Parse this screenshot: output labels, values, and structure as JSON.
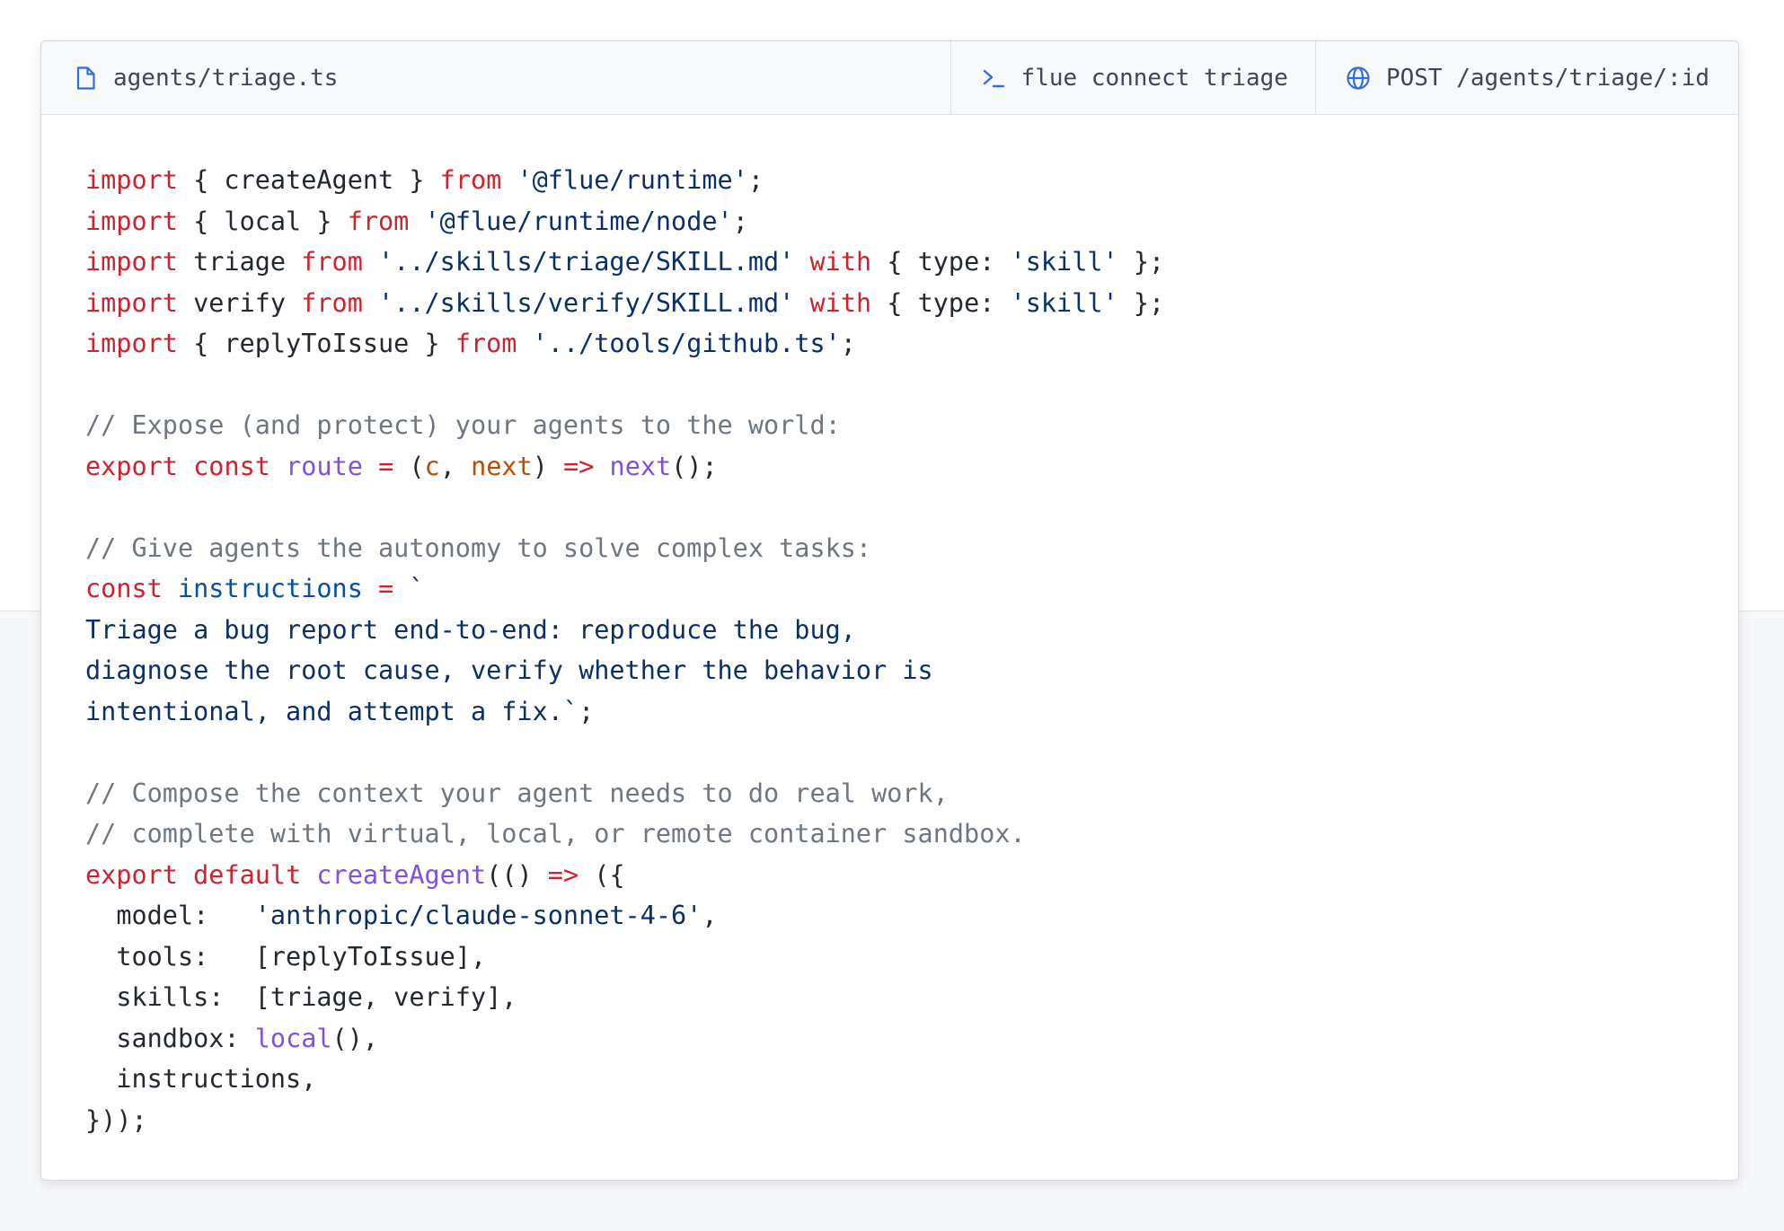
{
  "tabs": {
    "file": {
      "label": "agents/triage.ts",
      "icon": "file-icon"
    },
    "command": {
      "label": "flue connect triage",
      "icon": "terminal-icon"
    },
    "endpoint": {
      "label": "POST /agents/triage/:id",
      "icon": "globe-icon"
    }
  },
  "colors": {
    "keyword": "#cf222e",
    "string": "#0a3069",
    "comment": "#6e7781",
    "function": "#8250df",
    "variable": "#0550ae",
    "parameter": "#bc4c00",
    "accent": "#2f6fdc"
  },
  "code": {
    "lines": [
      [
        {
          "t": "kw",
          "v": "import"
        },
        {
          "t": "plain",
          "v": " { createAgent } "
        },
        {
          "t": "kw",
          "v": "from"
        },
        {
          "t": "plain",
          "v": " "
        },
        {
          "t": "str",
          "v": "'@flue/runtime'"
        },
        {
          "t": "plain",
          "v": ";"
        }
      ],
      [
        {
          "t": "kw",
          "v": "import"
        },
        {
          "t": "plain",
          "v": " { local } "
        },
        {
          "t": "kw",
          "v": "from"
        },
        {
          "t": "plain",
          "v": " "
        },
        {
          "t": "str",
          "v": "'@flue/runtime/node'"
        },
        {
          "t": "plain",
          "v": ";"
        }
      ],
      [
        {
          "t": "kw",
          "v": "import"
        },
        {
          "t": "plain",
          "v": " triage "
        },
        {
          "t": "kw",
          "v": "from"
        },
        {
          "t": "plain",
          "v": " "
        },
        {
          "t": "str",
          "v": "'../skills/triage/SKILL.md'"
        },
        {
          "t": "plain",
          "v": " "
        },
        {
          "t": "kw",
          "v": "with"
        },
        {
          "t": "plain",
          "v": " { type: "
        },
        {
          "t": "str",
          "v": "'skill'"
        },
        {
          "t": "plain",
          "v": " };"
        }
      ],
      [
        {
          "t": "kw",
          "v": "import"
        },
        {
          "t": "plain",
          "v": " verify "
        },
        {
          "t": "kw",
          "v": "from"
        },
        {
          "t": "plain",
          "v": " "
        },
        {
          "t": "str",
          "v": "'../skills/verify/SKILL.md'"
        },
        {
          "t": "plain",
          "v": " "
        },
        {
          "t": "kw",
          "v": "with"
        },
        {
          "t": "plain",
          "v": " { type: "
        },
        {
          "t": "str",
          "v": "'skill'"
        },
        {
          "t": "plain",
          "v": " };"
        }
      ],
      [
        {
          "t": "kw",
          "v": "import"
        },
        {
          "t": "plain",
          "v": " { replyToIssue } "
        },
        {
          "t": "kw",
          "v": "from"
        },
        {
          "t": "plain",
          "v": " "
        },
        {
          "t": "str",
          "v": "'../tools/github.ts'"
        },
        {
          "t": "plain",
          "v": ";"
        }
      ],
      [],
      [
        {
          "t": "cmt",
          "v": "// Expose (and protect) your agents to the world:"
        }
      ],
      [
        {
          "t": "kw",
          "v": "export"
        },
        {
          "t": "plain",
          "v": " "
        },
        {
          "t": "kw",
          "v": "const"
        },
        {
          "t": "plain",
          "v": " "
        },
        {
          "t": "fn",
          "v": "route"
        },
        {
          "t": "plain",
          "v": " "
        },
        {
          "t": "kw",
          "v": "="
        },
        {
          "t": "plain",
          "v": " ("
        },
        {
          "t": "prm",
          "v": "c"
        },
        {
          "t": "plain",
          "v": ", "
        },
        {
          "t": "prm",
          "v": "next"
        },
        {
          "t": "plain",
          "v": ") "
        },
        {
          "t": "kw",
          "v": "=>"
        },
        {
          "t": "plain",
          "v": " "
        },
        {
          "t": "fn",
          "v": "next"
        },
        {
          "t": "plain",
          "v": "();"
        }
      ],
      [],
      [
        {
          "t": "cmt",
          "v": "// Give agents the autonomy to solve complex tasks:"
        }
      ],
      [
        {
          "t": "kw",
          "v": "const"
        },
        {
          "t": "plain",
          "v": " "
        },
        {
          "t": "var",
          "v": "instructions"
        },
        {
          "t": "plain",
          "v": " "
        },
        {
          "t": "kw",
          "v": "="
        },
        {
          "t": "plain",
          "v": " "
        },
        {
          "t": "str",
          "v": "`"
        }
      ],
      [
        {
          "t": "str",
          "v": "Triage a bug report end-to-end: reproduce the bug,"
        }
      ],
      [
        {
          "t": "str",
          "v": "diagnose the root cause, verify whether the behavior is"
        }
      ],
      [
        {
          "t": "str",
          "v": "intentional, and attempt a fix.`"
        },
        {
          "t": "plain",
          "v": ";"
        }
      ],
      [],
      [
        {
          "t": "cmt",
          "v": "// Compose the context your agent needs to do real work,"
        }
      ],
      [
        {
          "t": "cmt",
          "v": "// complete with virtual, local, or remote container sandbox."
        }
      ],
      [
        {
          "t": "kw",
          "v": "export"
        },
        {
          "t": "plain",
          "v": " "
        },
        {
          "t": "kw",
          "v": "default"
        },
        {
          "t": "plain",
          "v": " "
        },
        {
          "t": "fn",
          "v": "createAgent"
        },
        {
          "t": "plain",
          "v": "(() "
        },
        {
          "t": "kw",
          "v": "=>"
        },
        {
          "t": "plain",
          "v": " ({"
        }
      ],
      [
        {
          "t": "plain",
          "v": "  model:   "
        },
        {
          "t": "str",
          "v": "'anthropic/claude-sonnet-4-6'"
        },
        {
          "t": "plain",
          "v": ","
        }
      ],
      [
        {
          "t": "plain",
          "v": "  tools:   [replyToIssue],"
        }
      ],
      [
        {
          "t": "plain",
          "v": "  skills:  [triage, verify],"
        }
      ],
      [
        {
          "t": "plain",
          "v": "  sandbox: "
        },
        {
          "t": "fn",
          "v": "local"
        },
        {
          "t": "plain",
          "v": "(),"
        }
      ],
      [
        {
          "t": "plain",
          "v": "  instructions,"
        }
      ],
      [
        {
          "t": "plain",
          "v": "}));"
        }
      ]
    ]
  }
}
